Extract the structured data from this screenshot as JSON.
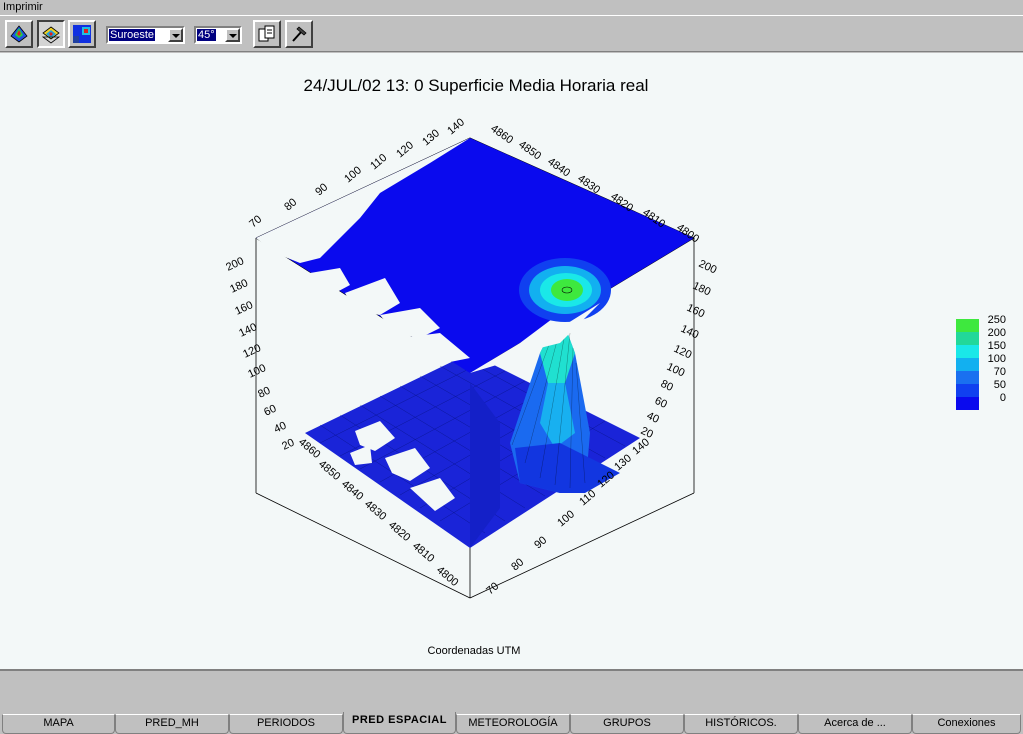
{
  "menu": {
    "print_label": "Imprimir"
  },
  "toolbar": {
    "direction_value": "Suroeste",
    "angle_value": "45°"
  },
  "plot": {
    "title": "24/JUL/02 13: 0   Superficie Media Horaria real",
    "footer": "Coordenadas UTM"
  },
  "chart_data": {
    "type": "surface3d",
    "title": "24/JUL/02 13: 0   Superficie Media Horaria real",
    "xlabel": "Coordenadas UTM",
    "x_ticks": [
      "70",
      "80",
      "90",
      "100",
      "110",
      "120",
      "130",
      "140"
    ],
    "y_ticks": [
      "4800",
      "4810",
      "4820",
      "4830",
      "4840",
      "4850",
      "4860"
    ],
    "z_ticks": [
      "20",
      "40",
      "60",
      "80",
      "100",
      "120",
      "140",
      "160",
      "180",
      "200"
    ],
    "legend": {
      "levels": [
        "250",
        "200",
        "150",
        "100",
        "70",
        "50",
        "0"
      ],
      "colors": [
        "#3ee83e",
        "#22d89a",
        "#1ae8e8",
        "#12b0f0",
        "#1a70f0",
        "#1040f0",
        "#0a0aee"
      ]
    },
    "surface_color": "#0a0aee",
    "peak_value_approx": 250
  },
  "tabs": [
    {
      "label": "MAPA"
    },
    {
      "label": "PRED_MH"
    },
    {
      "label": "PERIODOS"
    },
    {
      "label": "PRED  ESPACIAL"
    },
    {
      "label": "METEOROLOGÍA"
    },
    {
      "label": "GRUPOS"
    },
    {
      "label": "HISTÓRICOS."
    },
    {
      "label": "Acerca de ..."
    },
    {
      "label": "Conexiones"
    }
  ]
}
